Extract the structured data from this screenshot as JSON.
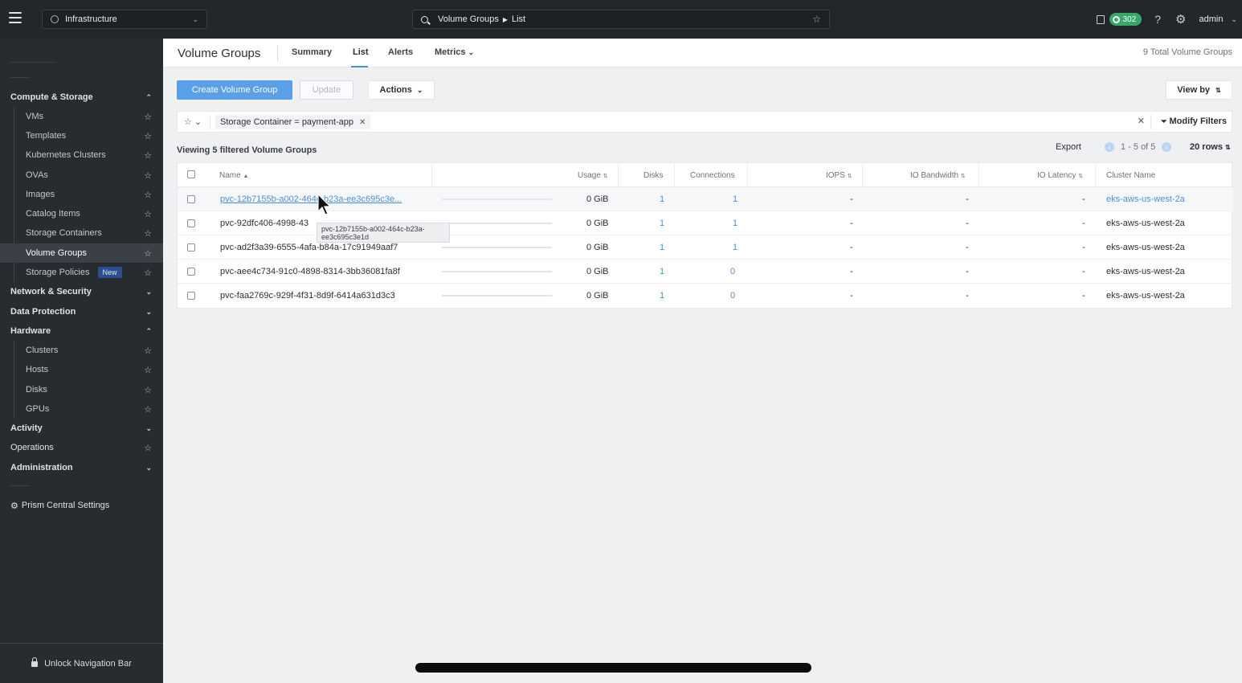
{
  "topbar": {
    "context": "Infrastructure",
    "search_text": "Volume Groups",
    "search_sub": "List",
    "alert_count": "302",
    "user": "admin"
  },
  "sidebar": {
    "compute_label": "Compute & Storage",
    "compute_items": [
      "VMs",
      "Templates",
      "Kubernetes Clusters",
      "OVAs",
      "Images",
      "Catalog Items",
      "Storage Containers",
      "Volume Groups",
      "Storage Policies"
    ],
    "new_badge": "New",
    "network_label": "Network & Security",
    "data_protection_label": "Data Protection",
    "hardware_label": "Hardware",
    "hardware_items": [
      "Clusters",
      "Hosts",
      "Disks",
      "GPUs"
    ],
    "activity_label": "Activity",
    "operations_label": "Operations",
    "administration_label": "Administration",
    "settings_label": "Prism Central Settings",
    "unlock_label": "Unlock Navigation Bar"
  },
  "main": {
    "title": "Volume Groups",
    "tabs": [
      "Summary",
      "List",
      "Alerts",
      "Metrics"
    ],
    "total": "9 Total Volume Groups",
    "create_btn": "Create Volume Group",
    "update_btn": "Update",
    "actions_btn": "Actions",
    "viewby_btn": "View by",
    "filter_chip": "Storage Container = payment-app",
    "modify_filters": "Modify Filters",
    "viewing": "Viewing 5 filtered Volume Groups",
    "export": "Export",
    "pager": "1 - 5 of 5",
    "rows_select": "20 rows"
  },
  "table": {
    "columns": [
      "Name",
      "Usage",
      "Disks",
      "Connections",
      "IOPS",
      "IO Bandwidth",
      "IO Latency",
      "Cluster Name"
    ],
    "rows": [
      {
        "name": "pvc-12b7155b-a002-464c-b23a-ee3c695c3e...",
        "usage": "0 GiB",
        "disks": "1",
        "connections": "1",
        "iops": "-",
        "bw": "-",
        "lat": "-",
        "cluster": "eks-aws-us-west-2a"
      },
      {
        "name": "pvc-92dfc406-4998-43",
        "usage": "0 GiB",
        "disks": "1",
        "connections": "1",
        "iops": "-",
        "bw": "-",
        "lat": "-",
        "cluster": "eks-aws-us-west-2a"
      },
      {
        "name": "pvc-ad2f3a39-6555-4afa-b84a-17c91949aaf7",
        "usage": "0 GiB",
        "disks": "1",
        "connections": "1",
        "iops": "-",
        "bw": "-",
        "lat": "-",
        "cluster": "eks-aws-us-west-2a"
      },
      {
        "name": "pvc-aee4c734-91c0-4898-8314-3bb36081fa8f",
        "usage": "0 GiB",
        "disks": "1",
        "connections": "0",
        "iops": "-",
        "bw": "-",
        "lat": "-",
        "cluster": "eks-aws-us-west-2a"
      },
      {
        "name": "pvc-faa2769c-929f-4f31-8d9f-6414a631d3c3",
        "usage": "0 GiB",
        "disks": "1",
        "connections": "0",
        "iops": "-",
        "bw": "-",
        "lat": "-",
        "cluster": "eks-aws-us-west-2a"
      }
    ],
    "tooltip_line1": "pvc-12b7155b-a002-464c-b23a-",
    "tooltip_line2": "ee3c695c3e1d"
  }
}
